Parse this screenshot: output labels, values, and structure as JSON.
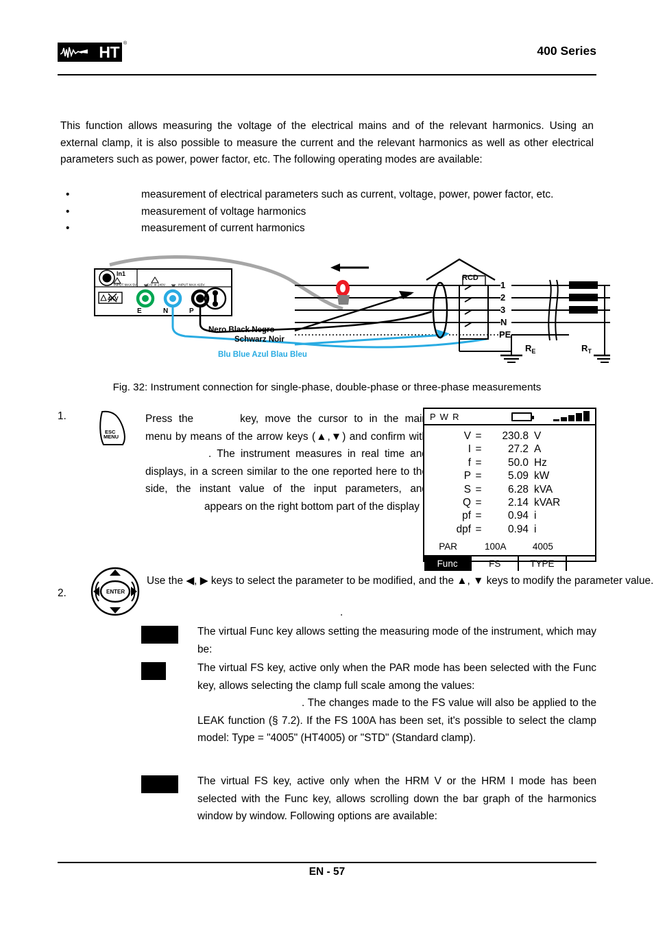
{
  "header": {
    "logo_text": "HT",
    "logo_reg": "®",
    "title": "400 Series"
  },
  "intro": {
    "paragraph": "This function allows measuring the voltage of the electrical mains and of the relevant harmonics. Using an external clamp, it is also possible to measure the current and the relevant harmonics as well as other electrical parameters such as power, power factor, etc. The following operating modes are available:"
  },
  "bullets": {
    "marker": "•",
    "items": [
      "measurement of electrical parameters such as current, voltage, power, power factor, etc.",
      "measurement of voltage harmonics",
      "measurement of current harmonics"
    ]
  },
  "figure": {
    "caption": "Fig. 32: Instrument connection for single-phase, double-phase or three-phase measurements",
    "instrument": {
      "input1_label": "In1",
      "input1_warning": "INPUT MAX 5V",
      "cat_label": "CAT III 240V",
      "input_max_label": "INPUT MAX 415V",
      "voltage_badge": "4KV",
      "terminal_e": "E",
      "terminal_n": "N",
      "terminal_p": "P"
    },
    "wire_labels": {
      "black_line1": "Nero  Black  Negro",
      "black_line2": "Schwarz  Noir",
      "blue_line": "Blu  Blue  Azul  Blau  Bleu"
    },
    "network": {
      "rcd": "RCD",
      "conductors": [
        "1",
        "2",
        "3",
        "N",
        "PE"
      ],
      "earth_e": "R",
      "earth_e_sub": "E",
      "earth_t": "R",
      "earth_t_sub": "T"
    }
  },
  "steps": [
    {
      "number": "1.",
      "icon_top": "ESC",
      "icon_bottom": "MENU",
      "text_part1": "Press the",
      "text_part2": "key, move the cursor to",
      "text_part3": "in the main menu by means of the arrow keys",
      "text_part4": "(▲,▼)  and  confirm  with",
      "text_part5": ".  The instrument measures in real time and displays, in a screen similar to the one reported here to the side, the instant value of the input parameters, and",
      "text_part6": "appears on the right bottom part of the display"
    },
    {
      "number": "2.",
      "icon_label": "ENTER",
      "text": "Use the ◀, ▶ keys to select the parameter to be modified, and the ▲, ▼ keys to modify the parameter value."
    }
  ],
  "stray_dot": ".",
  "lcd": {
    "mode": "P W R",
    "battery_icon": "battery-icon",
    "signal_icon": "signal-bars-icon",
    "readings": [
      {
        "symbol": "V",
        "eq": "=",
        "value": "230.8",
        "unit": "V"
      },
      {
        "symbol": "I",
        "eq": "=",
        "value": "27.2",
        "unit": "A"
      },
      {
        "symbol": "f",
        "eq": "=",
        "value": "50.0",
        "unit": "Hz"
      },
      {
        "symbol": "P",
        "eq": "=",
        "value": "5.09",
        "unit": "kW"
      },
      {
        "symbol": "S",
        "eq": "=",
        "value": "6.28",
        "unit": "kVA"
      },
      {
        "symbol": "Q",
        "eq": "=",
        "value": "2.14",
        "unit": "kVAR"
      },
      {
        "symbol": "pf",
        "eq": "=",
        "value": "0.94",
        "unit": "i"
      },
      {
        "symbol": "dpf",
        "eq": "=",
        "value": "0.94",
        "unit": "i"
      }
    ],
    "status": {
      "func": "PAR",
      "fs": "100A",
      "type": "4005",
      "blank": ""
    },
    "softkeys": [
      {
        "label": "Func",
        "active": true
      },
      {
        "label": "FS",
        "active": false
      },
      {
        "label": "TYPE",
        "active": false
      },
      {
        "label": "",
        "active": false
      }
    ]
  },
  "notes": [
    {
      "id": "note-1",
      "box": "black-box-placeholder",
      "text": "The virtual Func key allows setting the measuring mode of the instrument, which may be:"
    },
    {
      "id": "note-2",
      "box": "black-box-placeholder",
      "line1": "The virtual FS key, active only when the PAR mode has been selected with the Func key, allows selecting the clamp full scale among  the  values:",
      "line2": ". The changes made to the FS value will also be applied to the LEAK function (§ 7.2). If the FS 100A has been set, it's possible to select the clamp model: Type = \"4005\" (HT4005) or \"STD\" (Standard clamp)."
    },
    {
      "id": "note-3",
      "box": "black-box-placeholder",
      "text": "The virtual FS key, active only when the HRM V or the HRM I mode has been selected with the Func key, allows scrolling down the bar graph of the harmonics window by window. Following options  are  available:"
    }
  ],
  "footer": {
    "page_label": "EN - 57"
  },
  "colors": {
    "ink": "#000000",
    "paper": "#ffffff",
    "terminal_green": "#00a651",
    "terminal_blue": "#29abe2",
    "wire_blue": "#29abe2",
    "clamp_red": "#ed1c24",
    "clamp_grey": "#808080",
    "cable_grey": "#a6a6a6"
  }
}
